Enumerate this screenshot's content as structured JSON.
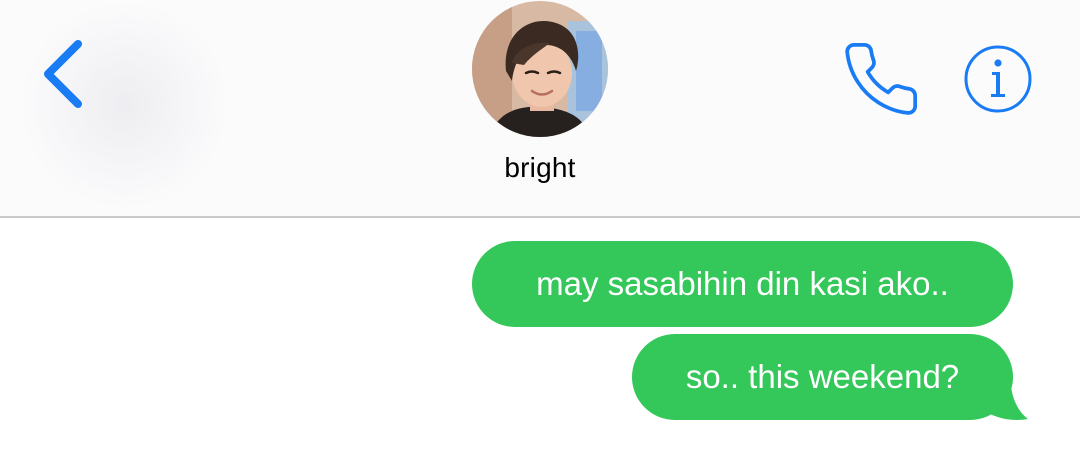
{
  "header": {
    "contact_name": "bright",
    "back_icon": "chevron-left-icon",
    "call_icon": "phone-icon",
    "info_icon": "info-icon",
    "accent_color": "#1a7cf5"
  },
  "messages": [
    {
      "direction": "outgoing",
      "text": "may sasabihin din kasi ako.."
    },
    {
      "direction": "outgoing",
      "text": "so.. this weekend?"
    }
  ],
  "colors": {
    "bubble": "#34c759",
    "bubble_text": "#ffffff"
  }
}
